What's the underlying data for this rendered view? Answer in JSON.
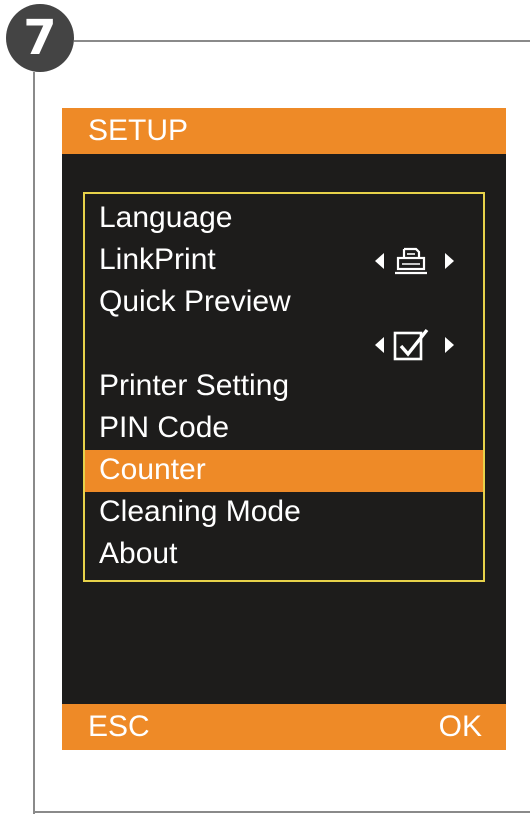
{
  "step": {
    "number": "7"
  },
  "screen": {
    "header_title": "SETUP",
    "menu_items": [
      {
        "label": "Language"
      },
      {
        "label": "LinkPrint",
        "value_icon": "printer-icon"
      },
      {
        "label": "Quick Preview"
      },
      {
        "label": "",
        "value_icon": "checkbox-checked-icon"
      },
      {
        "label": "Printer Setting"
      },
      {
        "label": "PIN Code"
      },
      {
        "label": "Counter",
        "selected": true
      },
      {
        "label": "Cleaning Mode"
      },
      {
        "label": "About"
      }
    ],
    "footer": {
      "left_label": "ESC",
      "right_label": "OK"
    }
  },
  "colors": {
    "accent": "#ee8a27",
    "screen_background": "#1d1c1b",
    "menu_border": "#e7d24a",
    "text": "#ffffff"
  }
}
